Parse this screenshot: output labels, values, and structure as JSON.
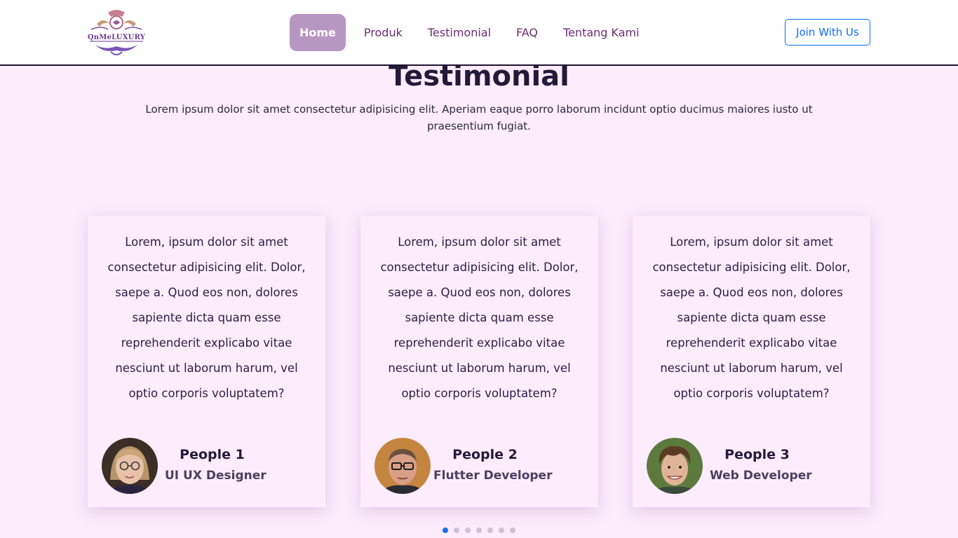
{
  "brand": {
    "logo_text": "QnMeLUXURY",
    "logo_colors": [
      "#c07a9a",
      "#6a3b8f"
    ]
  },
  "nav": {
    "items": [
      {
        "label": "Home",
        "active": true
      },
      {
        "label": "Produk",
        "active": false
      },
      {
        "label": "Testimonial",
        "active": false
      },
      {
        "label": "FAQ",
        "active": false
      },
      {
        "label": "Tentang Kami",
        "active": false
      }
    ],
    "cta_label": "Join With Us"
  },
  "section": {
    "title": "Testimonial",
    "description": "Lorem ipsum dolor sit amet consectetur adipisicing elit. Aperiam eaque porro laborum incidunt optio ducimus maiores iusto ut praesentium fugiat."
  },
  "testimonials": [
    {
      "quote": "Lorem, ipsum dolor sit amet consectetur adipisicing elit. Dolor, saepe a. Quod eos non, dolores sapiente dicta quam esse reprehenderit explicabo vitae nesciunt ut laborum harum, vel optio corporis voluptatem?",
      "name": "People 1",
      "role": "UI UX Designer",
      "avatar": "photo-woman-glasses"
    },
    {
      "quote": "Lorem, ipsum dolor sit amet consectetur adipisicing elit. Dolor, saepe a. Quod eos non, dolores sapiente dicta quam esse reprehenderit explicabo vitae nesciunt ut laborum harum, vel optio corporis voluptatem?",
      "name": "People 2",
      "role": "Flutter Developer",
      "avatar": "photo-man-glasses"
    },
    {
      "quote": "Lorem, ipsum dolor sit amet consectetur adipisicing elit. Dolor, saepe a. Quod eos non, dolores sapiente dicta quam esse reprehenderit explicabo vitae nesciunt ut laborum harum, vel optio corporis voluptatem?",
      "name": "People 3",
      "role": "Web Developer",
      "avatar": "photo-young-man"
    }
  ],
  "carousel": {
    "page_count": 7,
    "active_index": 0
  },
  "colors": {
    "background": "#fcecfc",
    "nav_active_bg": "#b896c2",
    "nav_text": "#6b2d73",
    "cta_blue": "#0d6efd",
    "heading": "#231a3a"
  }
}
